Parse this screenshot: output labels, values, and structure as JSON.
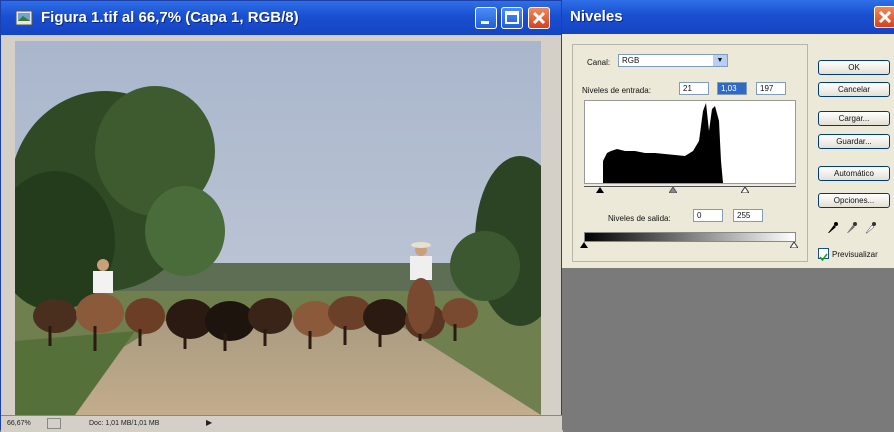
{
  "doc_window": {
    "title": "Figura 1.tif al 66,7% (Capa 1, RGB/8)",
    "status": {
      "zoom": "66,67%",
      "doc": "Doc: 1,01 MB/1,01 MB"
    }
  },
  "levels": {
    "title": "Niveles",
    "channel_label": "Canal:",
    "channel_value": "RGB",
    "input_label": "Niveles de entrada:",
    "input_values": [
      "21",
      "1,03",
      "197"
    ],
    "output_label": "Niveles de salida:",
    "output_values": [
      "0",
      "255"
    ],
    "buttons": {
      "ok": "OK",
      "cancel": "Cancelar",
      "load": "Cargar...",
      "save": "Guardar...",
      "auto": "Automático",
      "options": "Opciones..."
    },
    "preview_label": "Previsualizar",
    "preview_checked": true
  },
  "colors": {
    "titlebar": "#1f55d6",
    "dialog_bg": "#ece9d8",
    "close_button": "#e0532a"
  },
  "icons": [
    "photoshop-doc-icon",
    "minimize-icon",
    "maximize-icon",
    "close-icon",
    "chevron-down-icon",
    "eyedropper-black-icon",
    "eyedropper-gray-icon",
    "eyedropper-white-icon",
    "checkbox-icon"
  ]
}
